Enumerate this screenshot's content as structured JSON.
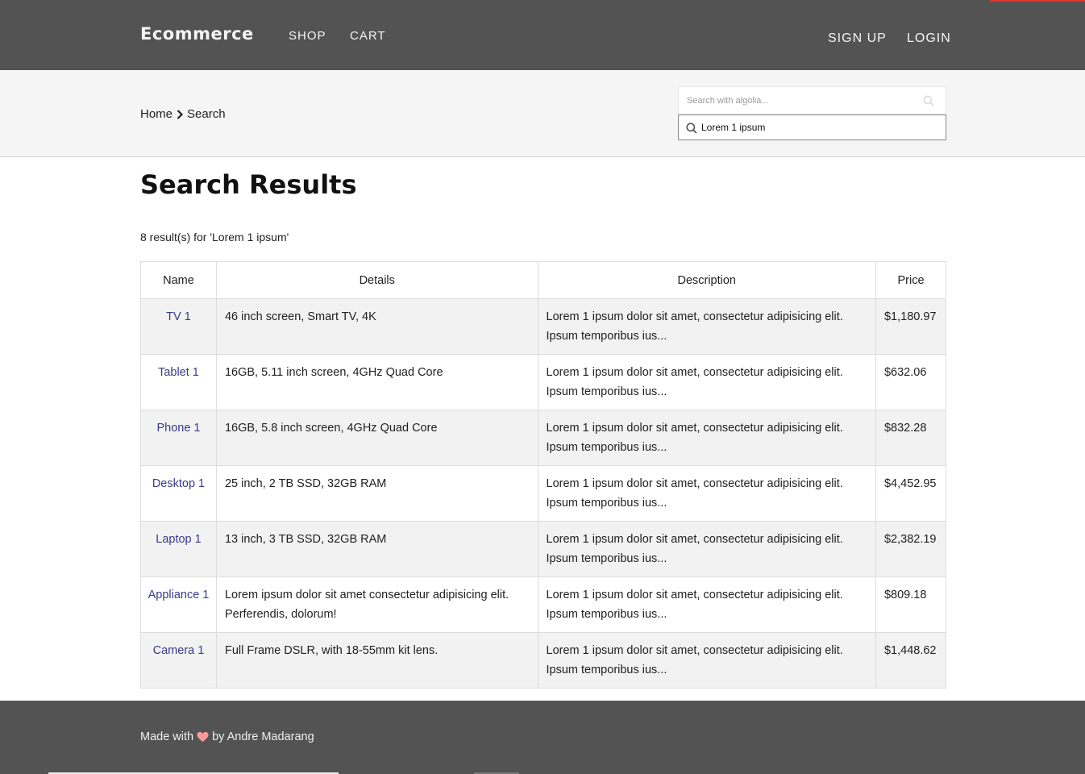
{
  "header": {
    "brand": "Ecommerce",
    "nav": {
      "shop": "SHOP",
      "cart": "CART",
      "signup": "SIGN UP",
      "login": "LOGIN"
    },
    "accent_color": "#e3342f",
    "background": "#535353"
  },
  "breadcrumb": {
    "home": "Home",
    "current": "Search",
    "separator_icon": "chevron-right-icon"
  },
  "search": {
    "algolia_placeholder": "Search with algolia...",
    "query_value": "Lorem 1 ipsum"
  },
  "main": {
    "title": "Search Results",
    "result_count": "8 result(s) for 'Lorem 1 ipsum'",
    "columns": {
      "name": "Name",
      "details": "Details",
      "description": "Description",
      "price": "Price"
    },
    "rows": [
      {
        "name": "TV 1",
        "details": "46 inch screen, Smart TV, 4K",
        "description": "Lorem 1 ipsum dolor sit amet, consectetur adipisicing elit. Ipsum temporibus ius...",
        "price": "$1,180.97"
      },
      {
        "name": "Tablet 1",
        "details": "16GB, 5.11 inch screen, 4GHz Quad Core",
        "description": "Lorem 1 ipsum dolor sit amet, consectetur adipisicing elit. Ipsum temporibus ius...",
        "price": "$632.06"
      },
      {
        "name": "Phone 1",
        "details": "16GB, 5.8 inch screen, 4GHz Quad Core",
        "description": "Lorem 1 ipsum dolor sit amet, consectetur adipisicing elit. Ipsum temporibus ius...",
        "price": "$832.28"
      },
      {
        "name": "Desktop 1",
        "details": "25 inch, 2 TB SSD, 32GB RAM",
        "description": "Lorem 1 ipsum dolor sit amet, consectetur adipisicing elit. Ipsum temporibus ius...",
        "price": "$4,452.95"
      },
      {
        "name": "Laptop 1",
        "details": "13 inch, 3 TB SSD, 32GB RAM",
        "description": "Lorem 1 ipsum dolor sit amet, consectetur adipisicing elit. Ipsum temporibus ius...",
        "price": "$2,382.19"
      },
      {
        "name": "Appliance 1",
        "details": "Lorem ipsum dolor sit amet consectetur adipisicing elit. Perferendis, dolorum!",
        "description": "Lorem 1 ipsum dolor sit amet, consectetur adipisicing elit. Ipsum temporibus ius...",
        "price": "$809.18"
      },
      {
        "name": "Camera 1",
        "details": "Full Frame DSLR, with 18-55mm kit lens.",
        "description": "Lorem 1 ipsum dolor sit amet, consectetur adipisicing elit. Ipsum temporibus ius...",
        "price": "$1,448.62"
      }
    ]
  },
  "footer": {
    "made_with": "Made with",
    "by": "by Andre Madarang",
    "heart_color": "#ff9a9a"
  }
}
